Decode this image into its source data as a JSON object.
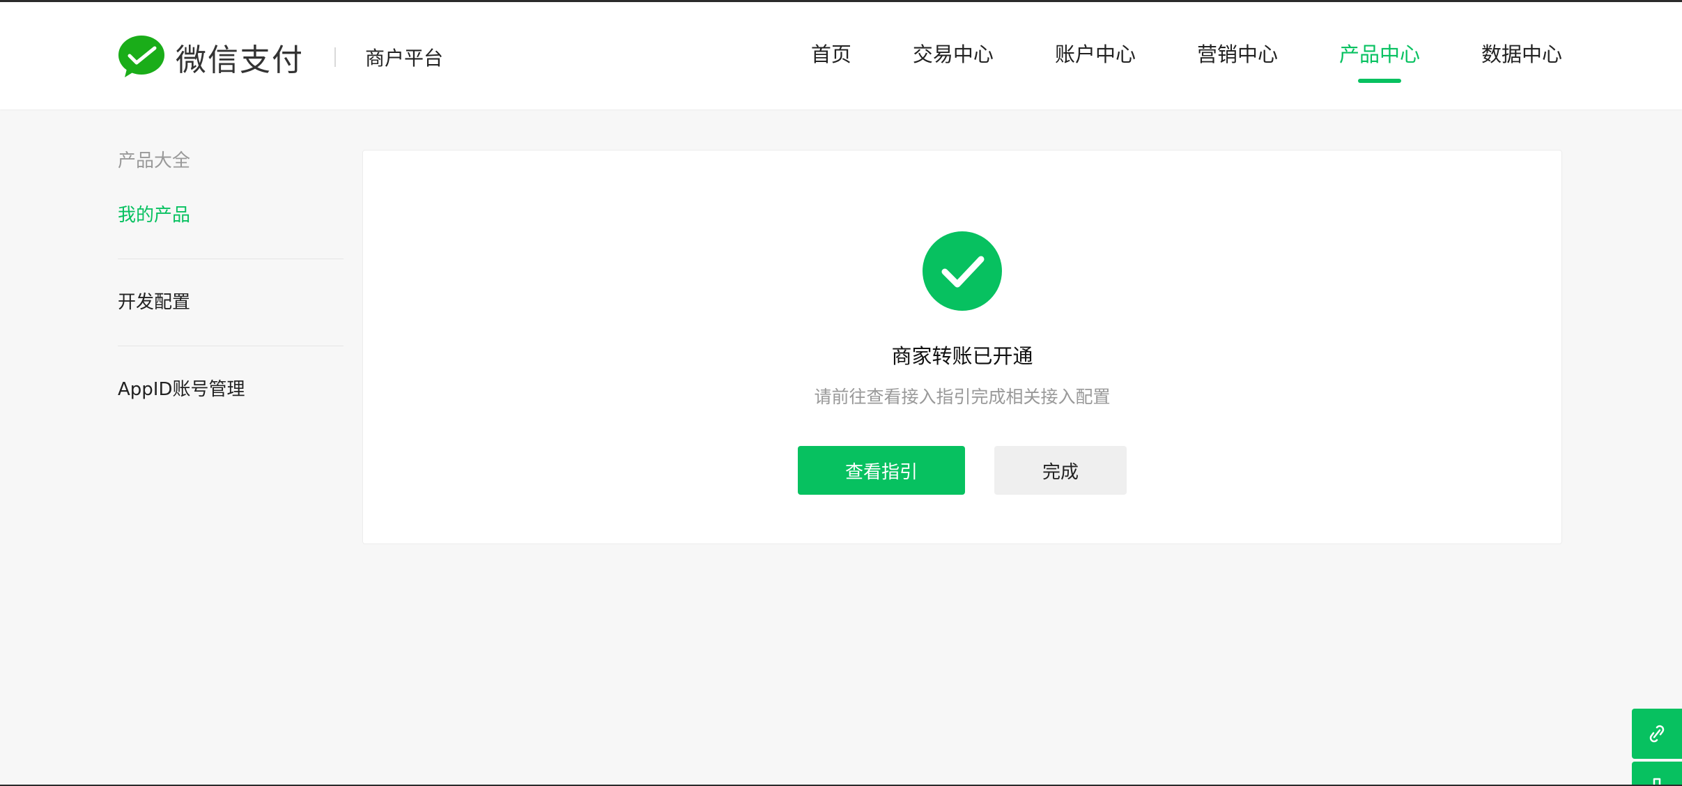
{
  "brand": {
    "name": "微信支付",
    "sub": "商户平台"
  },
  "nav": {
    "items": [
      {
        "label": "首页"
      },
      {
        "label": "交易中心"
      },
      {
        "label": "账户中心"
      },
      {
        "label": "营销中心"
      },
      {
        "label": "产品中心"
      },
      {
        "label": "数据中心"
      }
    ],
    "active_index": 4
  },
  "sidebar": {
    "group_title": "产品大全",
    "items": [
      {
        "label": "我的产品",
        "active": true
      },
      {
        "label": "开发配置",
        "active": false
      },
      {
        "label": "AppID账号管理",
        "active": false
      }
    ]
  },
  "result": {
    "title": "商家转账已开通",
    "description": "请前往查看接入指引完成相关接入配置",
    "primary_button": "查看指引",
    "secondary_button": "完成",
    "icon": "check-circle-icon"
  },
  "float_tools": {
    "top_icon": "link-icon",
    "bottom_icon": "download-icon"
  },
  "colors": {
    "brand_green": "#07c160",
    "muted_text": "#999999",
    "button_grey": "#efefef"
  }
}
